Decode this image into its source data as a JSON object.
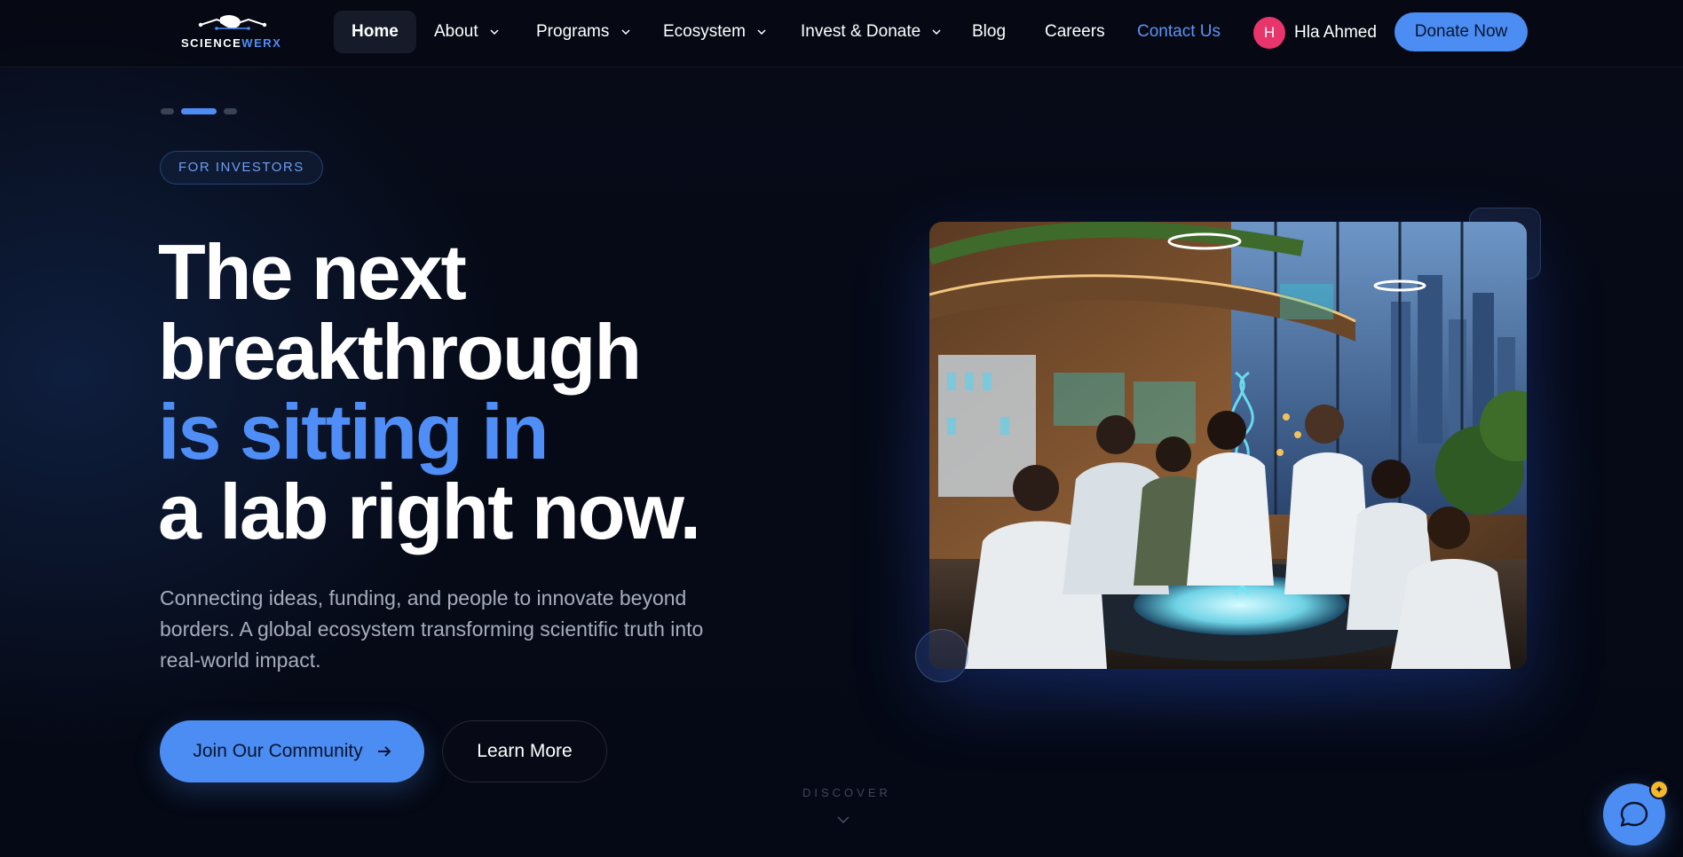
{
  "nav": {
    "logo_text_main": "SCIENCE",
    "logo_text_accent": "WERX",
    "items": [
      {
        "label": "Home"
      },
      {
        "label": "About"
      },
      {
        "label": "Programs"
      },
      {
        "label": "Ecosystem"
      },
      {
        "label": "Invest & Donate"
      },
      {
        "label": "Blog"
      },
      {
        "label": "Careers"
      },
      {
        "label": "Contact Us"
      }
    ],
    "user": {
      "initial": "H",
      "name": "Hla Ahmed"
    },
    "donate_label": "Donate Now"
  },
  "hero": {
    "badge": "FOR INVESTORS",
    "headline": {
      "line1": "The next",
      "line2": "breakthrough",
      "line3": "is sitting in",
      "line4": "a lab right now."
    },
    "subtext": "Connecting ideas, funding, and people to innovate beyond borders. A global ecosystem transforming scientific truth into real-world impact.",
    "primary_cta": "Join Our Community",
    "secondary_cta": "Learn More",
    "discover": "DISCOVER"
  },
  "slider": {
    "count": 3,
    "active_index": 1
  },
  "colors": {
    "accent": "#4b8df2",
    "background": "#060a17",
    "avatar": "#e8356c",
    "spark": "#f5b82a"
  },
  "icons": [
    "handshake-logo-icon",
    "chevron-down-icon",
    "arrow-right-icon",
    "chat-icon",
    "sparkle-icon"
  ]
}
